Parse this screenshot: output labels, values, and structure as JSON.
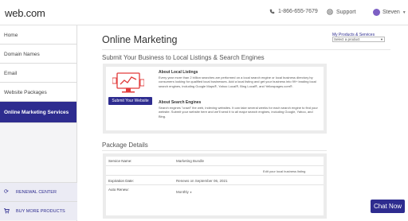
{
  "header": {
    "logo": "web.com",
    "phone": "1-866-655-7679",
    "support": "Support",
    "user": "Steven"
  },
  "sidebar": {
    "items": [
      {
        "label": "Home"
      },
      {
        "label": "Domain Names"
      },
      {
        "label": "Email"
      },
      {
        "label": "Website Packages"
      },
      {
        "label": "Online Marketing Services"
      }
    ],
    "renewal": "RENEWAL CENTER",
    "buy": "BUY MORE PRODUCTS"
  },
  "main": {
    "title": "Online Marketing",
    "products_link": "My Products & Services",
    "products_select": "Select a product",
    "submit_section_title": "Submit Your Business to Local Listings & Search Engines",
    "submit_button": "Submit Your Website",
    "local_title": "About Local Listings",
    "local_text": "Every year more than 2 billion searches are performed on a local search engine or local business directory by consumers looking for qualified local businesses. Add a local listing and get your business into 99+ leading local search engines, including Google Maps®, Yahoo Local®, Bing Local®, and Yellowpages.com®.",
    "search_title": "About Search Engines",
    "search_text": "Search engines \"crawl\" the web, indexing websites. It can take several weeks for each search engine to find your website. Submit your website here and we'll send it to all major search engines, including Google, Yahoo, and Bing.",
    "package_title": "Package Details",
    "rows": {
      "service_label": "Service Name:",
      "service_value": "Marketing Bundle",
      "edit_link": "Edit your local business listing",
      "expiration_label": "Expiration Date:",
      "expiration_value": "Renews on September 06, 2021",
      "autorenew_label": "Auto Renew:",
      "autorenew_value": "Monthly"
    }
  },
  "chat": "Chat Now",
  "colors": {
    "brand": "#2e2c8f",
    "illustration": "#e23a3a"
  }
}
